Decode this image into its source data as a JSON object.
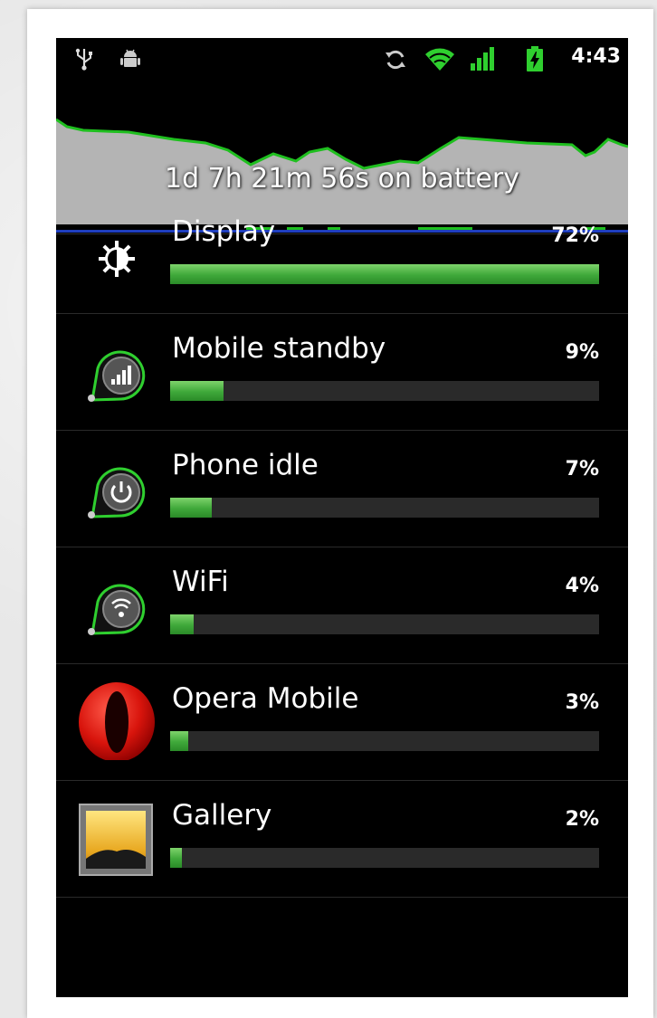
{
  "status_bar": {
    "time": "4:43",
    "icons": [
      "usb-icon",
      "android-debug-icon",
      "sync-icon",
      "wifi-icon",
      "signal-icon",
      "battery-charging-icon"
    ]
  },
  "battery_graph": {
    "label": "1d 7h 21m 56s on battery"
  },
  "usage_items": [
    {
      "label": "Display",
      "percent_text": "72%",
      "percent": 72,
      "icon": "brightness-icon"
    },
    {
      "label": "Mobile standby",
      "percent_text": "9%",
      "percent": 9,
      "icon": "cell-signal-icon"
    },
    {
      "label": "Phone idle",
      "percent_text": "7%",
      "percent": 7,
      "icon": "power-icon"
    },
    {
      "label": "WiFi",
      "percent_text": "4%",
      "percent": 4,
      "icon": "wifi-icon"
    },
    {
      "label": "Opera Mobile",
      "percent_text": "3%",
      "percent": 3,
      "icon": "opera-icon"
    },
    {
      "label": "Gallery",
      "percent_text": "2%",
      "percent": 2,
      "icon": "gallery-icon"
    }
  ],
  "colors": {
    "bar_green": "#3fa83a",
    "graph_line": "#1fbf1f",
    "graph_fill": "#b4b4b4"
  }
}
